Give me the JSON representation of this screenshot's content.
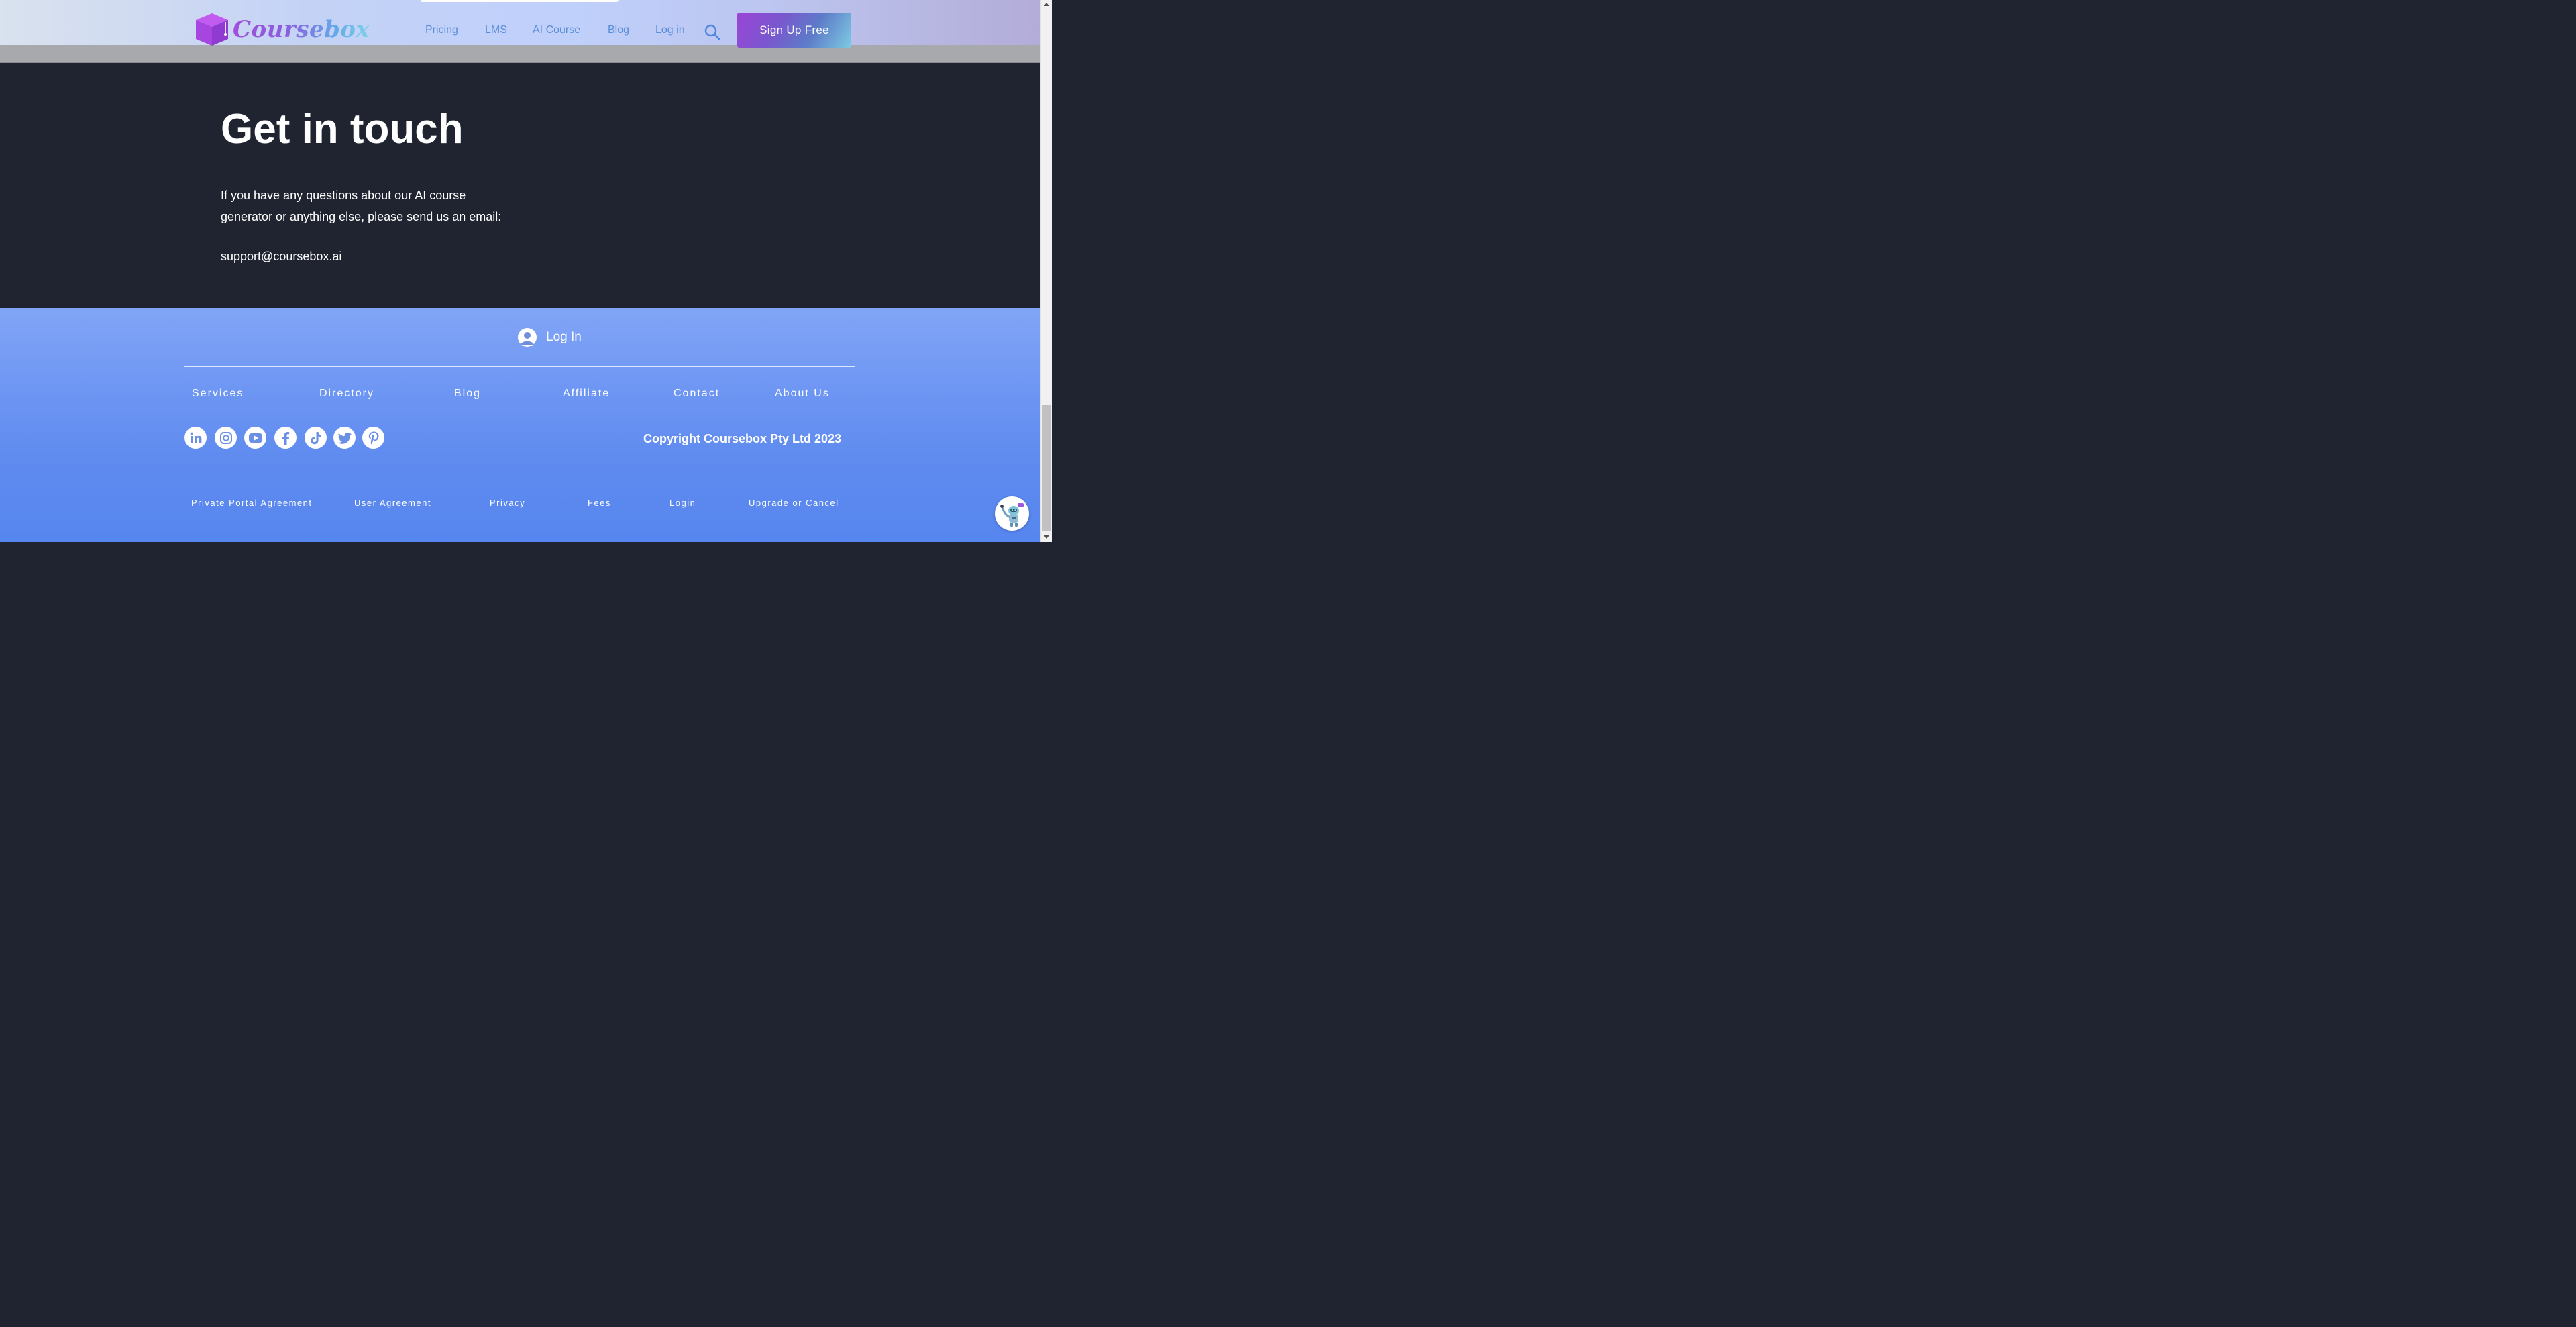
{
  "header": {
    "brand": "Coursebox",
    "nav": [
      "Pricing",
      "LMS",
      "AI Course",
      "Blog",
      "Log in"
    ],
    "signup_label": "Sign Up Free",
    "colors": {
      "accent_purple": "#9b45d6",
      "accent_blue": "#5b8ed8",
      "accent_cyan": "#7dcbe3"
    }
  },
  "contact": {
    "title": "Get in touch",
    "body_line1": "If you have any questions about our AI course",
    "body_line2": "generator or anything else, please send us an email:",
    "email": "support@coursebox.ai"
  },
  "footer": {
    "login_label": "Log In",
    "links": [
      "Services",
      "Directory",
      "Blog",
      "Affiliate",
      "Contact",
      "About Us"
    ],
    "social": [
      "linkedin-icon",
      "instagram-icon",
      "youtube-icon",
      "facebook-icon",
      "tiktok-icon",
      "twitter-icon",
      "pinterest-icon"
    ],
    "copyright": "Copyright Coursebox Pty Ltd 2023",
    "bottom_links": [
      "Private Portal Agreement",
      "User Agreement",
      "Privacy",
      "Fees",
      "Login",
      "Upgrade or Cancel"
    ]
  },
  "chat": {
    "icon": "chatbot-icon"
  }
}
